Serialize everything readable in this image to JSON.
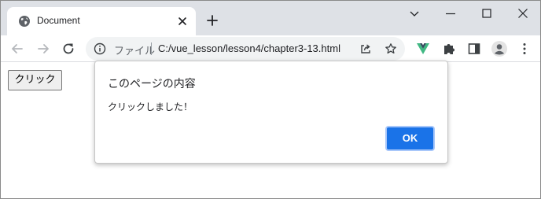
{
  "tab": {
    "title": "Document"
  },
  "omnibox": {
    "scheme_label": "ファイル",
    "url": "C:/vue_lesson/lesson4/chapter3-13.html"
  },
  "page": {
    "button_label": "クリック"
  },
  "dialog": {
    "title": "このページの内容",
    "message": "クリックしました！",
    "ok_label": "OK"
  },
  "colors": {
    "tabstrip_bg": "#dee1e6",
    "accent_blue": "#1a73e8",
    "vue_green": "#41b883",
    "vue_dark": "#35495e"
  },
  "icons": [
    "globe-icon",
    "close-icon",
    "plus-icon",
    "chevron-down-icon",
    "minimize-icon",
    "maximize-icon",
    "close-window-icon",
    "back-arrow-icon",
    "forward-arrow-icon",
    "reload-icon",
    "info-icon",
    "share-icon",
    "star-icon",
    "vue-devtools-icon",
    "puzzle-icon",
    "side-panel-icon",
    "profile-icon",
    "kebab-menu-icon"
  ]
}
